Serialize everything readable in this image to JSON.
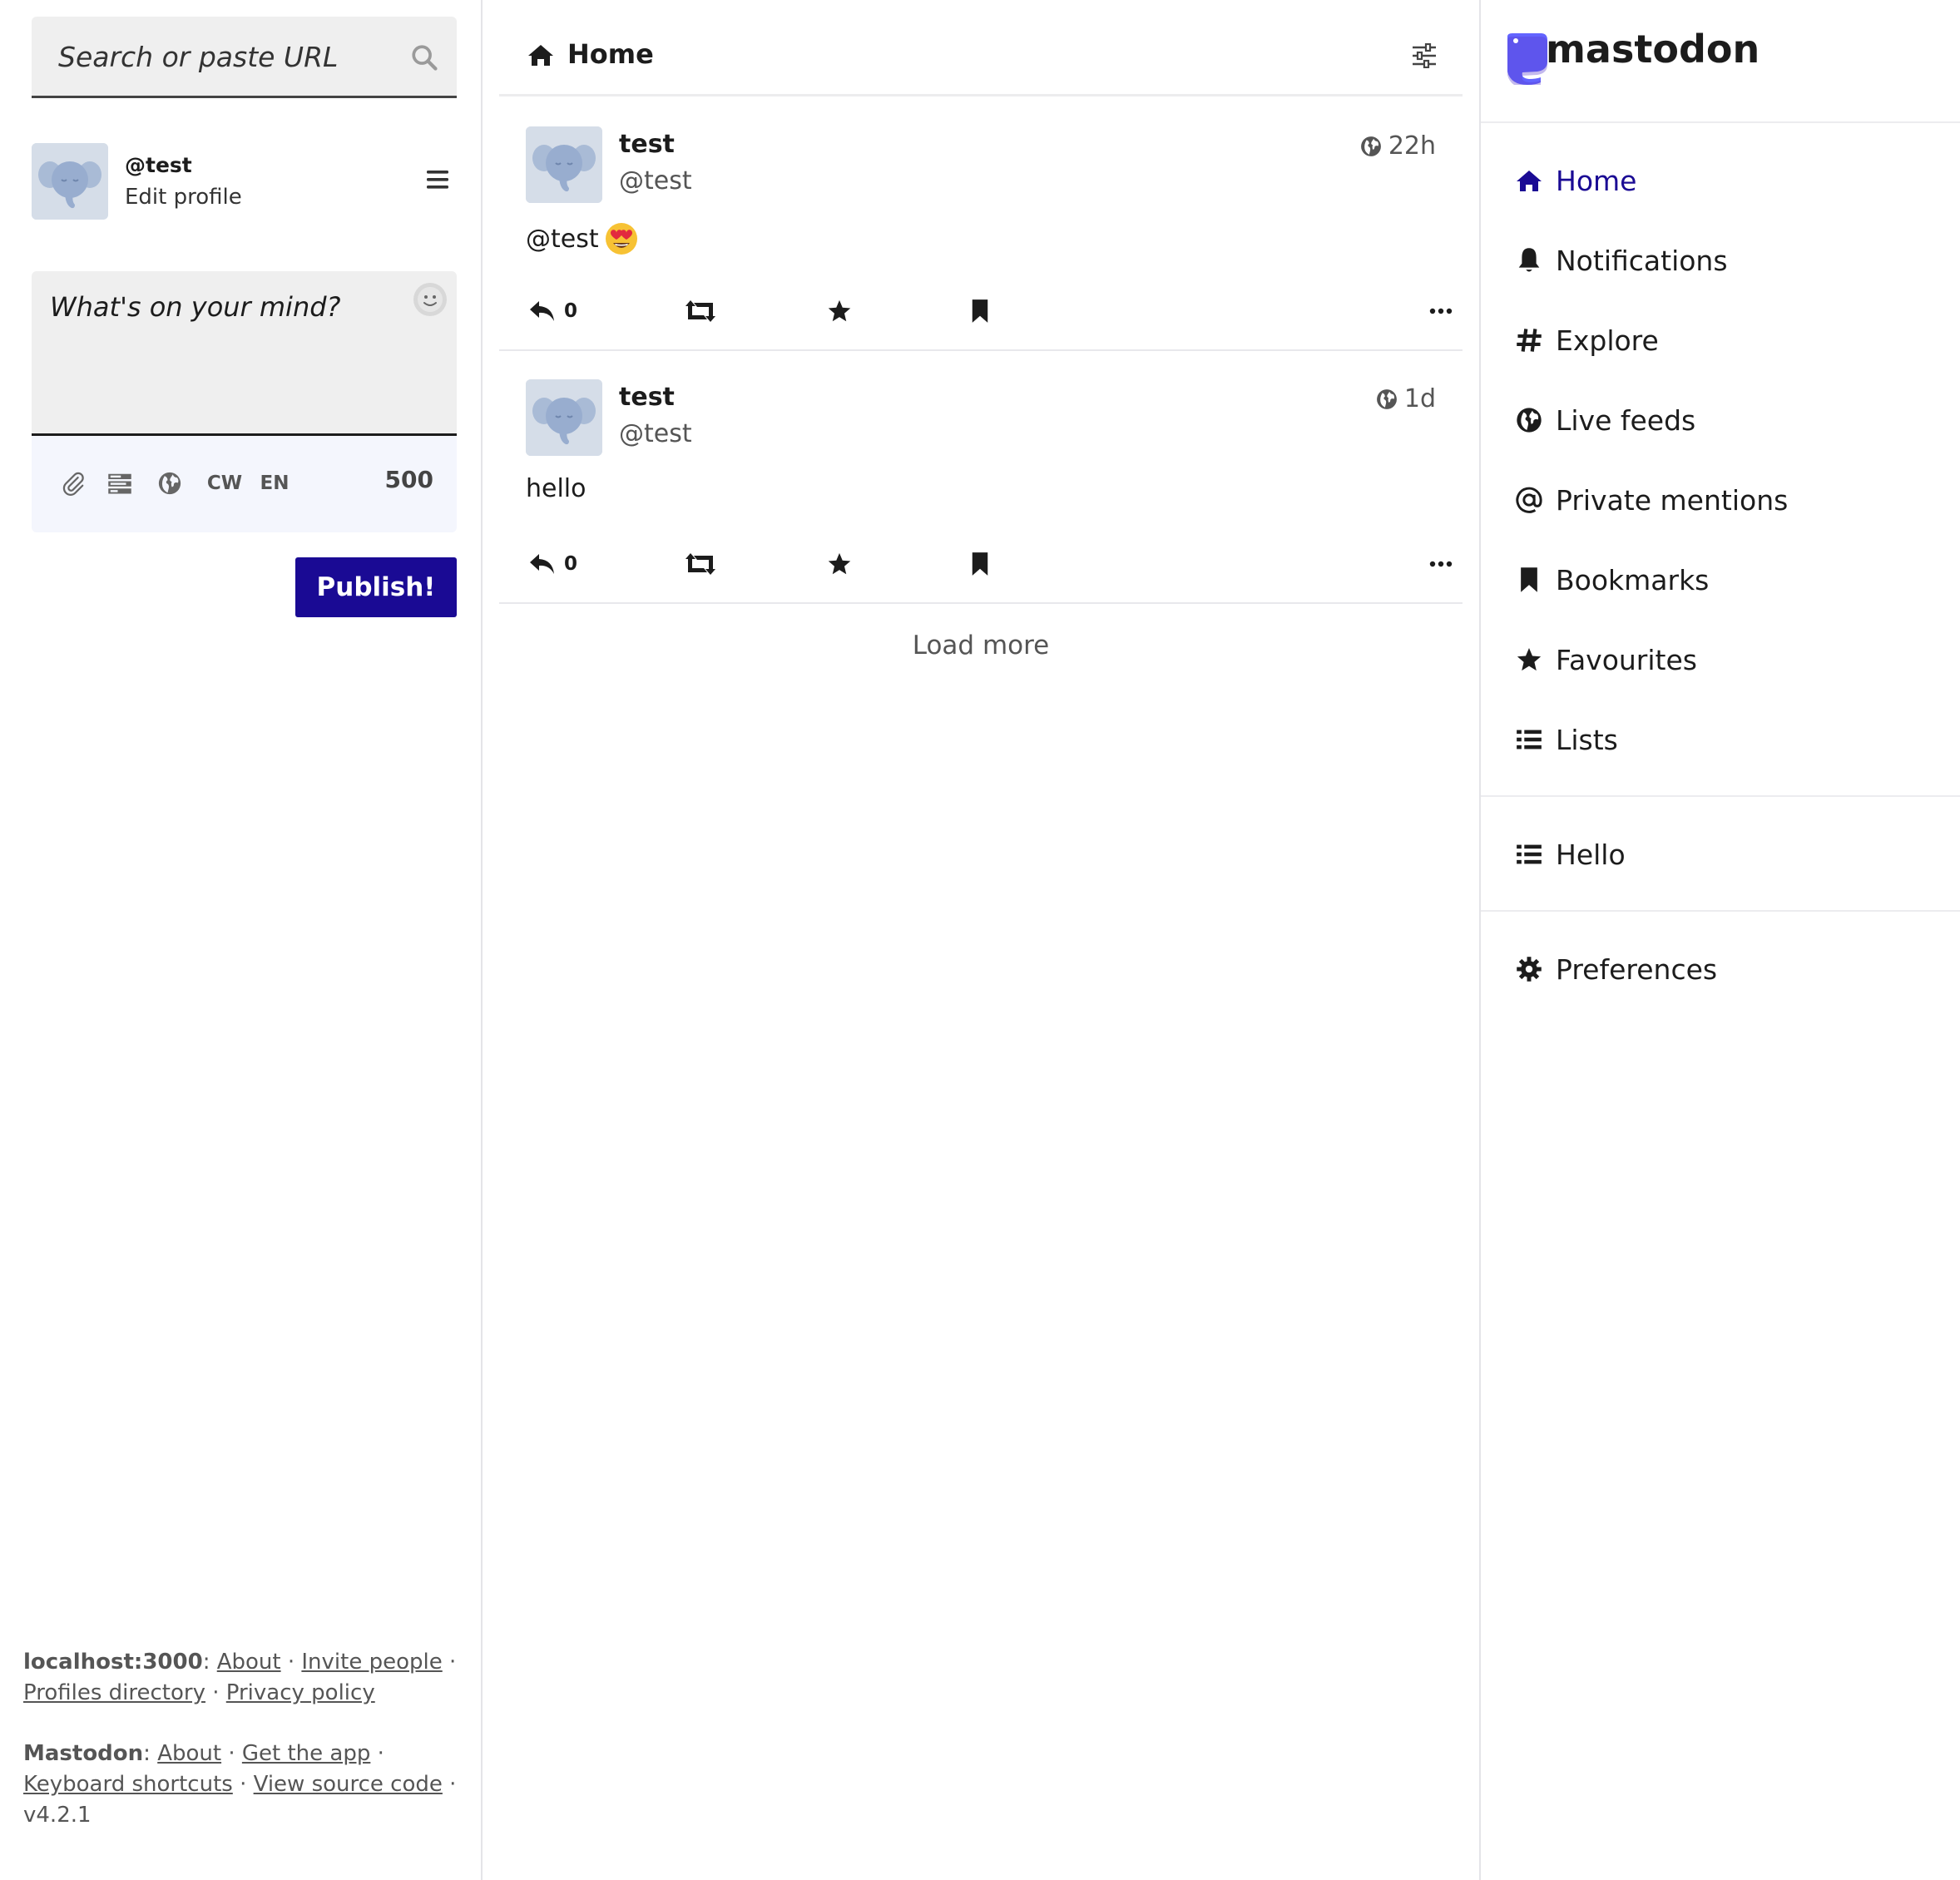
{
  "search": {
    "placeholder": "Search or paste URL"
  },
  "profile": {
    "handle": "@test",
    "edit_label": "Edit profile"
  },
  "composer": {
    "placeholder": "What's on your mind?",
    "cw_label": "CW",
    "language_label": "EN",
    "char_count": "500",
    "publish_label": "Publish!"
  },
  "column": {
    "title": "Home"
  },
  "statuses": [
    {
      "name": "test",
      "handle": "@test",
      "time": "22h",
      "content": "@test",
      "content_emoji": "heart-eyes-emoji",
      "reply_count": "0"
    },
    {
      "name": "test",
      "handle": "@test",
      "time": "1d",
      "content": "hello",
      "reply_count": "0"
    }
  ],
  "load_more_label": "Load more",
  "logo": {
    "text": "mastodon"
  },
  "nav": {
    "items": [
      {
        "label": "Home",
        "icon": "home-icon",
        "active": true
      },
      {
        "label": "Notifications",
        "icon": "bell-icon"
      },
      {
        "label": "Explore",
        "icon": "hashtag-icon"
      },
      {
        "label": "Live feeds",
        "icon": "globe-icon"
      },
      {
        "label": "Private mentions",
        "icon": "at-icon"
      },
      {
        "label": "Bookmarks",
        "icon": "bookmark-icon"
      },
      {
        "label": "Favourites",
        "icon": "star-icon"
      },
      {
        "label": "Lists",
        "icon": "list-icon"
      }
    ],
    "lists": [
      {
        "label": "Hello",
        "icon": "list-icon"
      }
    ],
    "preferences": {
      "label": "Preferences",
      "icon": "gear-icon"
    }
  },
  "footer": {
    "server_name": "localhost:3000",
    "server_links": [
      "About",
      "Invite people",
      "Profiles directory",
      "Privacy policy"
    ],
    "mastodon_name": "Mastodon",
    "mastodon_links": [
      "About",
      "Get the app",
      "Keyboard shortcuts",
      "View source code"
    ],
    "version": "v4.2.1"
  },
  "colors": {
    "accent": "#1a0a94",
    "brand": "#6364ff",
    "input_bg": "#efefef",
    "toolbar_bg": "#f4f6fd",
    "muted_text": "#555555",
    "avatar_bg": "#d5dde8"
  }
}
